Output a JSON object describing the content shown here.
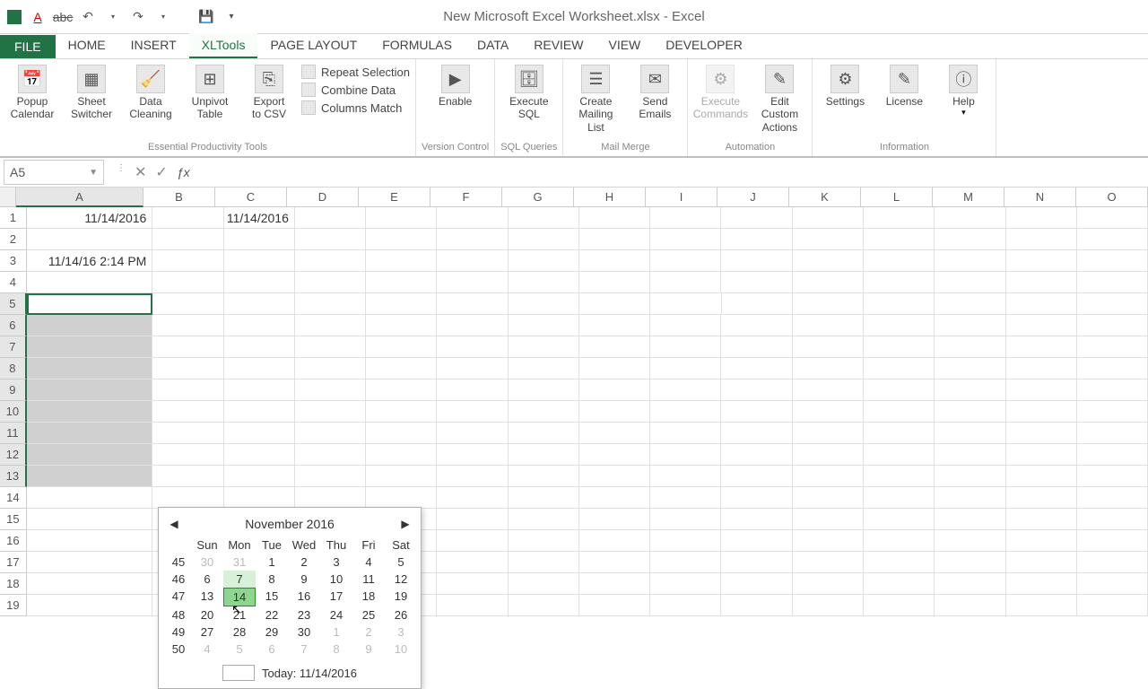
{
  "window": {
    "title": "New Microsoft Excel Worksheet.xlsx - Excel"
  },
  "qat": {
    "font_color": "A",
    "strikethrough": "abc"
  },
  "tabs": {
    "file": "FILE",
    "items": [
      "HOME",
      "INSERT",
      "XLTools",
      "PAGE LAYOUT",
      "FORMULAS",
      "DATA",
      "REVIEW",
      "VIEW",
      "DEVELOPER"
    ],
    "active": "XLTools"
  },
  "ribbon": {
    "groups": [
      {
        "label": "Essential Productivity Tools",
        "big": [
          {
            "label": "Popup Calendar",
            "icon": "cal"
          },
          {
            "label": "Sheet Switcher",
            "icon": "sheet"
          },
          {
            "label": "Data Cleaning",
            "icon": "clean"
          },
          {
            "label": "Unpivot Table",
            "icon": "unpivot"
          },
          {
            "label": "Export to CSV",
            "icon": "csv"
          }
        ],
        "mini": [
          {
            "label": "Repeat Selection"
          },
          {
            "label": "Combine Data"
          },
          {
            "label": "Columns Match"
          }
        ]
      },
      {
        "label": "Version Control",
        "big": [
          {
            "label": "Enable",
            "icon": "play"
          }
        ]
      },
      {
        "label": "SQL Queries",
        "big": [
          {
            "label": "Execute SQL",
            "icon": "sql"
          }
        ]
      },
      {
        "label": "Mail Merge",
        "big": [
          {
            "label": "Create Mailing List",
            "icon": "list"
          },
          {
            "label": "Send Emails",
            "icon": "mail"
          }
        ]
      },
      {
        "label": "Automation",
        "big": [
          {
            "label": "Execute Commands",
            "icon": "exec",
            "disabled": true
          },
          {
            "label": "Edit Custom Actions",
            "icon": "edit"
          }
        ]
      },
      {
        "label": "Information",
        "big": [
          {
            "label": "Settings",
            "icon": "gear"
          },
          {
            "label": "License",
            "icon": "pen"
          },
          {
            "label": "Help",
            "icon": "info",
            "dropdown": true
          }
        ]
      }
    ]
  },
  "namebox": {
    "value": "A5"
  },
  "formula": {
    "value": ""
  },
  "columns": [
    "A",
    "B",
    "C",
    "D",
    "E",
    "F",
    "G",
    "H",
    "I",
    "J",
    "K",
    "L",
    "M",
    "N",
    "O"
  ],
  "rows": [
    1,
    2,
    3,
    4,
    5,
    6,
    7,
    8,
    9,
    10,
    11,
    12,
    13,
    14,
    15,
    16,
    17,
    18,
    19
  ],
  "cells": {
    "A1": "11/14/2016",
    "C1": "11/14/2016",
    "A3": "11/14/16 2:14 PM"
  },
  "selection": {
    "active": "A5",
    "range_rows": [
      5,
      6,
      7,
      8,
      9,
      10,
      11,
      12,
      13
    ]
  },
  "calendar": {
    "month_label": "November 2016",
    "dow": [
      "Sun",
      "Mon",
      "Tue",
      "Wed",
      "Thu",
      "Fri",
      "Sat"
    ],
    "weeks": [
      {
        "wk": 45,
        "days": [
          {
            "d": 30,
            "o": true
          },
          {
            "d": 31,
            "o": true
          },
          {
            "d": 1
          },
          {
            "d": 2
          },
          {
            "d": 3
          },
          {
            "d": 4
          },
          {
            "d": 5
          }
        ]
      },
      {
        "wk": 46,
        "days": [
          {
            "d": 6
          },
          {
            "d": 7,
            "hover": true
          },
          {
            "d": 8
          },
          {
            "d": 9
          },
          {
            "d": 10
          },
          {
            "d": 11
          },
          {
            "d": 12
          }
        ]
      },
      {
        "wk": 47,
        "days": [
          {
            "d": 13
          },
          {
            "d": 14,
            "today": true
          },
          {
            "d": 15
          },
          {
            "d": 16
          },
          {
            "d": 17
          },
          {
            "d": 18
          },
          {
            "d": 19
          }
        ]
      },
      {
        "wk": 48,
        "days": [
          {
            "d": 20
          },
          {
            "d": 21
          },
          {
            "d": 22
          },
          {
            "d": 23
          },
          {
            "d": 24
          },
          {
            "d": 25
          },
          {
            "d": 26
          }
        ]
      },
      {
        "wk": 49,
        "days": [
          {
            "d": 27
          },
          {
            "d": 28
          },
          {
            "d": 29
          },
          {
            "d": 30
          },
          {
            "d": 1,
            "o": true
          },
          {
            "d": 2,
            "o": true
          },
          {
            "d": 3,
            "o": true
          }
        ]
      },
      {
        "wk": 50,
        "days": [
          {
            "d": 4,
            "o": true
          },
          {
            "d": 5,
            "o": true
          },
          {
            "d": 6,
            "o": true
          },
          {
            "d": 7,
            "o": true
          },
          {
            "d": 8,
            "o": true
          },
          {
            "d": 9,
            "o": true
          },
          {
            "d": 10,
            "o": true
          }
        ]
      }
    ],
    "today_label": "Today: 11/14/2016"
  }
}
